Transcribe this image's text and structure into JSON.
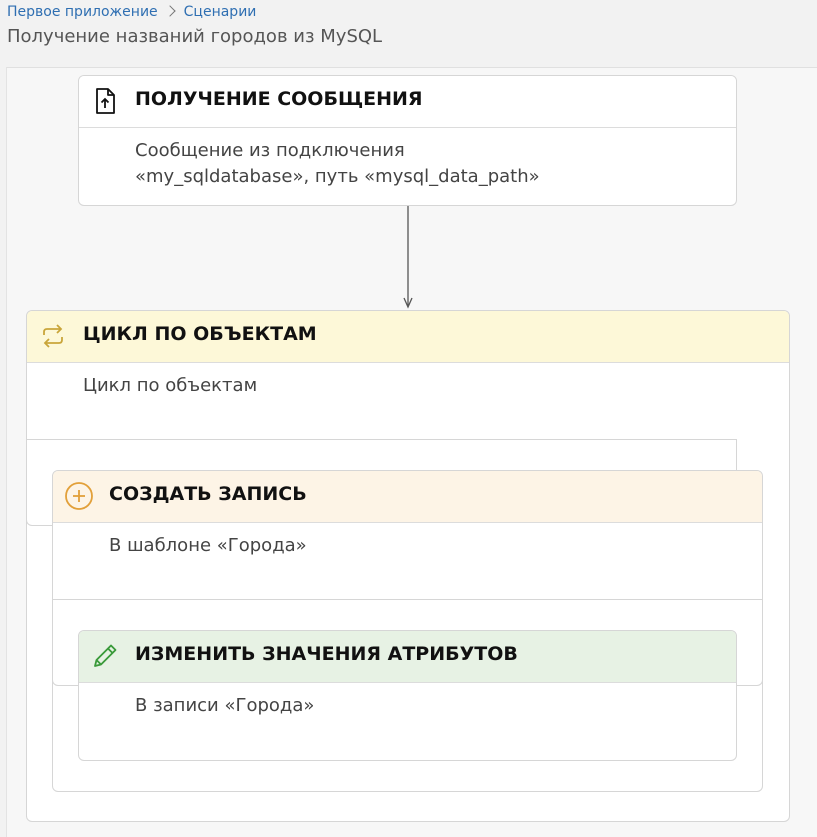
{
  "breadcrumb": {
    "app": "Первое приложение",
    "section": "Сценарии"
  },
  "page_title": "Получение названий городов из MySQL",
  "colors": {
    "link": "#2f6fb2",
    "loop_header": "#fdf8d8",
    "loop_icon": "#c9a53a",
    "create_header": "#fdf4e6",
    "create_icon": "#e2a03a",
    "edit_header": "#e7f2e4",
    "edit_icon": "#3a9a3a"
  },
  "nodes": {
    "get_message": {
      "title": "ПОЛУЧЕНИЕ СООБЩЕНИЯ",
      "desc_line1": "Сообщение из подключения",
      "desc_line2": "«my_sqldatabase», путь «mysql_data_path»",
      "icon": "file-upload-icon"
    },
    "loop": {
      "title": "ЦИКЛ ПО ОБЪЕКТАМ",
      "desc": "Цикл по объектам",
      "icon": "loop-icon"
    },
    "create_record": {
      "title": "СОЗДАТЬ ЗАПИСЬ",
      "desc": "В шаблоне «Города»",
      "icon": "plus-circle-icon"
    },
    "edit_attributes": {
      "title": "ИЗМЕНИТЬ ЗНАЧЕНИЯ АТРИБУТОВ",
      "desc": "В записи «Города»",
      "icon": "pencil-icon"
    }
  }
}
